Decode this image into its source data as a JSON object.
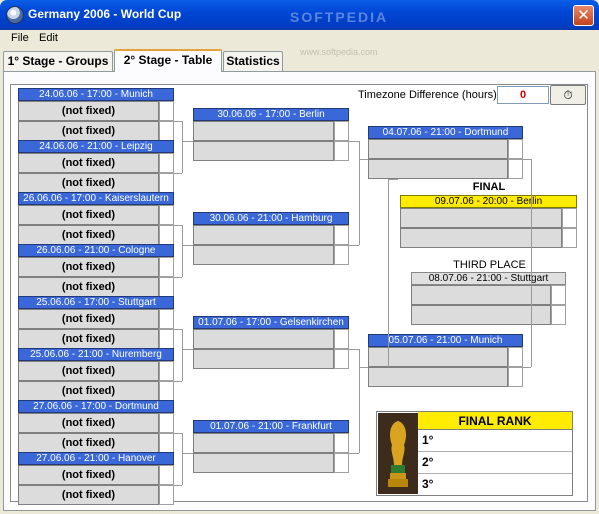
{
  "window": {
    "title": "Germany 2006 - World Cup",
    "close_glyph": "✕",
    "watermark": "SOFTPEDIA",
    "watermark_url": "www.softpedia.com"
  },
  "menu": [
    "File",
    "Edit"
  ],
  "tabs": [
    "1° Stage - Groups",
    "2° Stage - Table",
    "Statistics"
  ],
  "active_tab": 1,
  "timezone": {
    "label": "Timezone Difference (hours):",
    "value": "0"
  },
  "team_placeholder": "(not fixed)",
  "round_of_16": [
    "24.06.06 - 17:00 - Munich",
    "24.06.06 - 21:00 - Leipzig",
    "26.06.06 - 17:00 - Kaiserslautern",
    "26.06.06 - 21:00 - Cologne",
    "25.06.06 - 17:00 - Stuttgart",
    "25.06.06 - 21:00 - Nuremberg",
    "27.06.06 - 17:00 - Dortmund",
    "27.06.06 - 21:00 - Hanover"
  ],
  "quarter_finals": [
    "30.06.06 - 17:00 - Berlin",
    "30.06.06 - 21:00 - Hamburg",
    "01.07.06 - 17:00 - Gelsenkirchen",
    "01.07.06 - 21:00 - Frankfurt"
  ],
  "semi_finals": [
    "04.07.06 - 21:00 - Dortmund",
    "05.07.06 - 21:00 - Munich"
  ],
  "final": {
    "label": "FINAL",
    "header": "09.07.06 - 20:00 - Berlin"
  },
  "third_place": {
    "label": "THIRD PLACE",
    "header": "08.07.06 - 21:00 - Stuttgart"
  },
  "final_rank": {
    "title": "FINAL RANK",
    "places": [
      "1°",
      "2°",
      "3°"
    ]
  },
  "colors": {
    "header_blue": "#3a68d8",
    "final_yellow": "#ffec00",
    "timezone_red": "#d00000"
  }
}
